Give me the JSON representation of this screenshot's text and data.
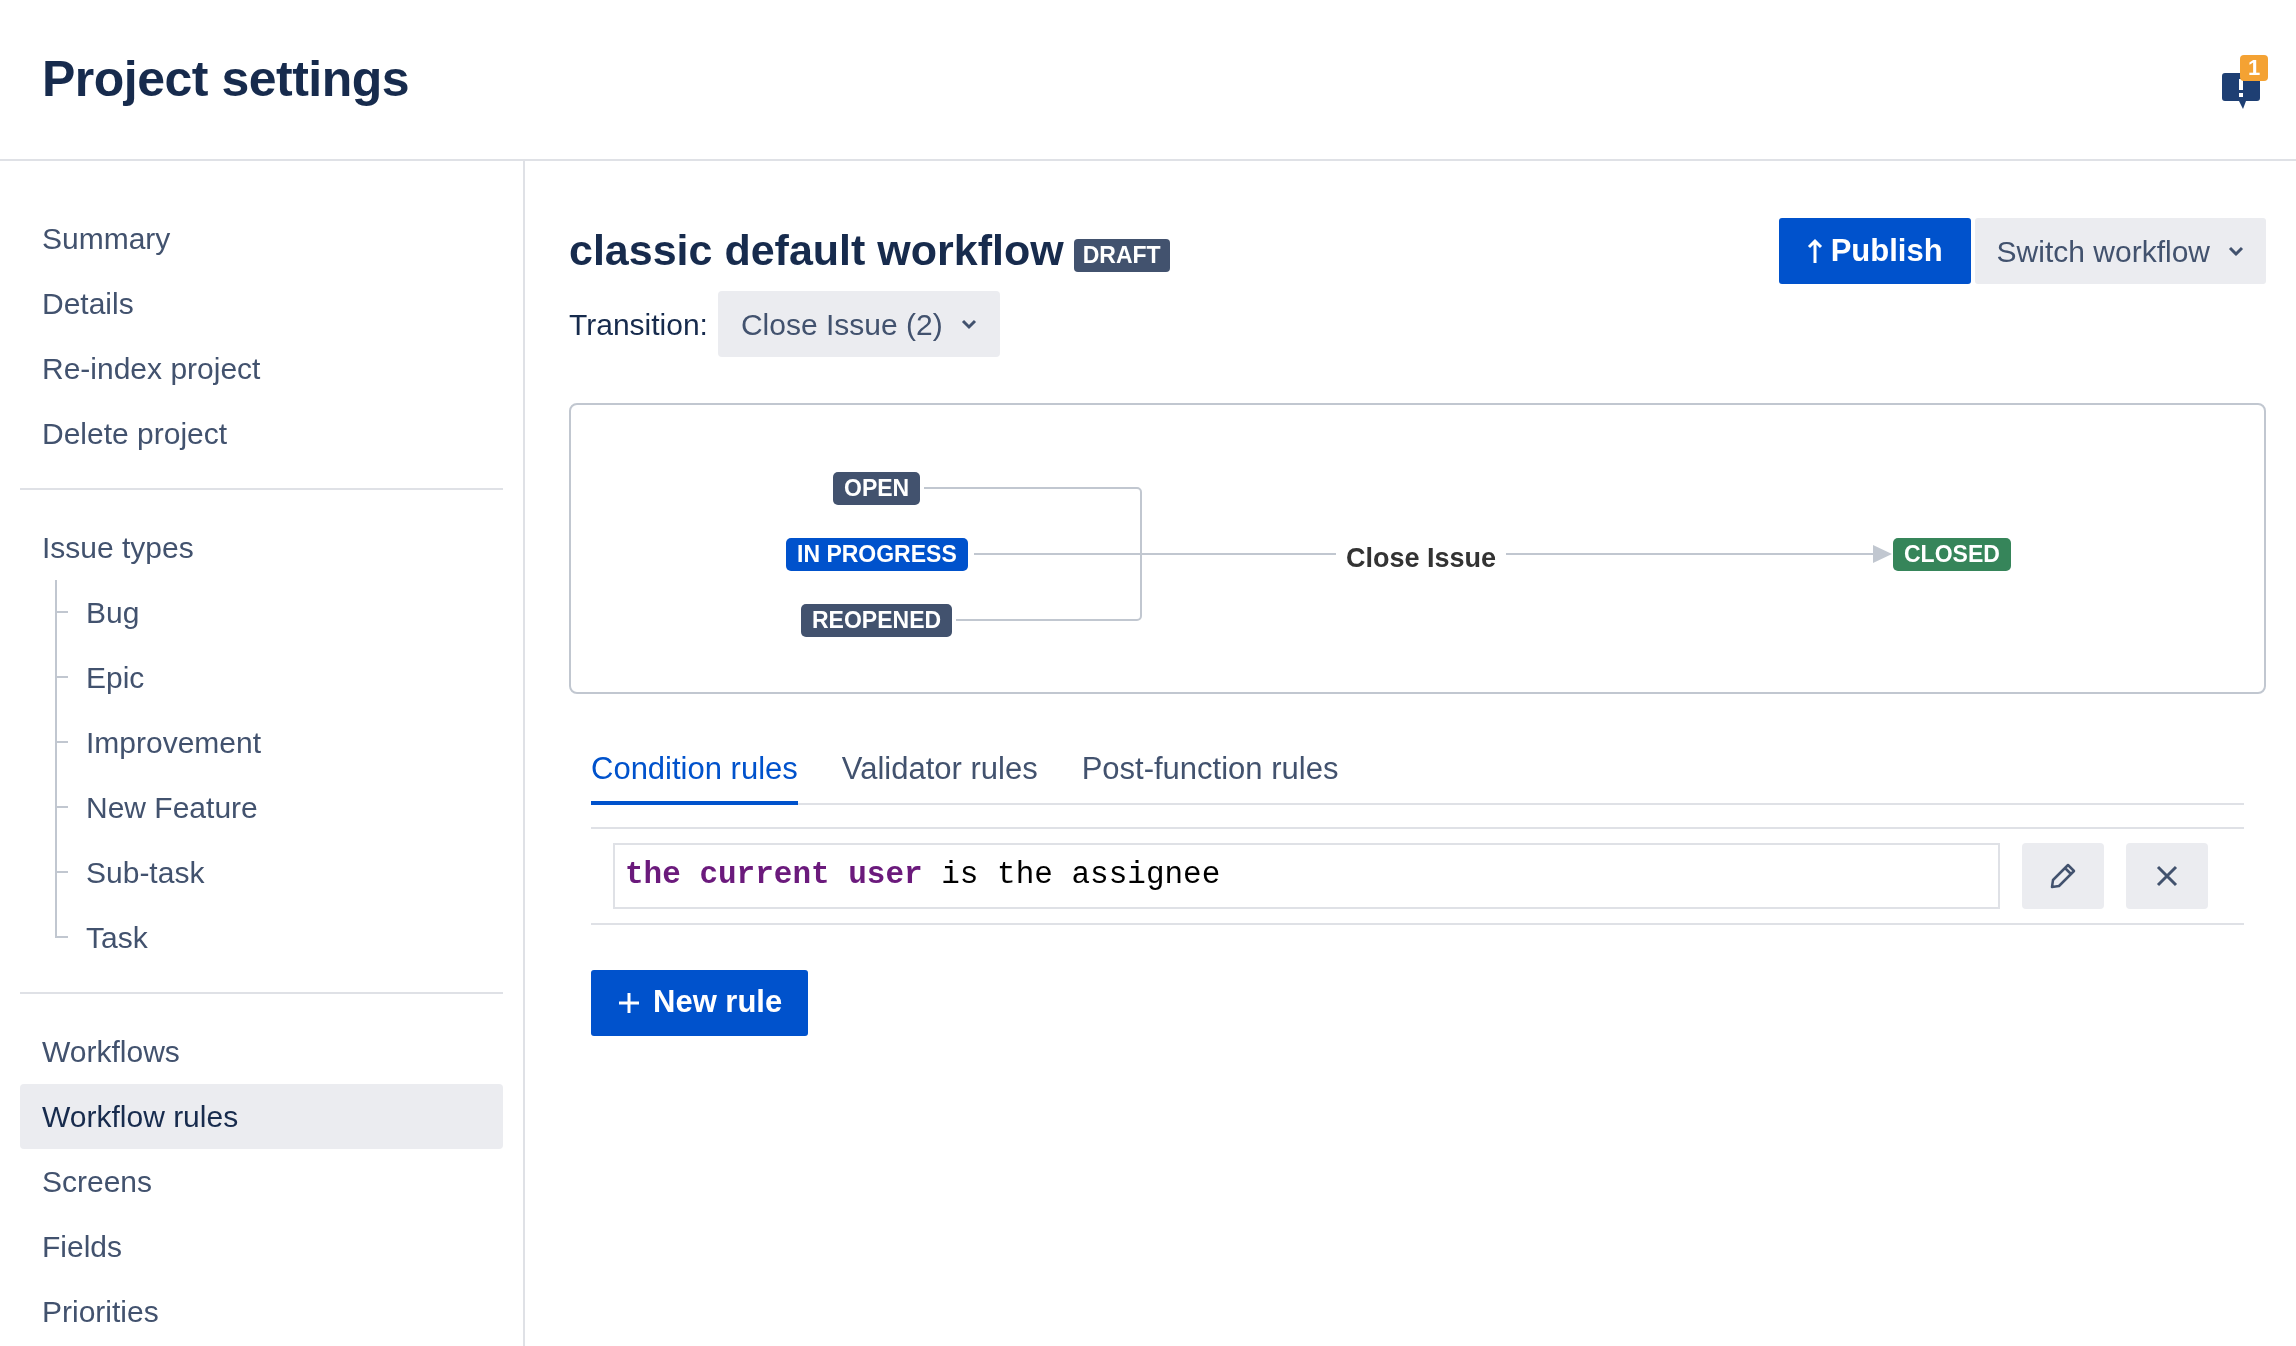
{
  "header": {
    "title": "Project settings",
    "notification_count": "1"
  },
  "sidebar": {
    "sections": [
      {
        "items": [
          {
            "label": "Summary",
            "selected": false
          },
          {
            "label": "Details",
            "selected": false
          },
          {
            "label": "Re-index project",
            "selected": false
          },
          {
            "label": "Delete project",
            "selected": false
          }
        ]
      },
      {
        "items": [
          {
            "label": "Issue types",
            "selected": false,
            "children": [
              {
                "label": "Bug",
                "selected": false
              },
              {
                "label": "Epic",
                "selected": false
              },
              {
                "label": "Improvement",
                "selected": false
              },
              {
                "label": "New Feature",
                "selected": false
              },
              {
                "label": "Sub-task",
                "selected": false
              },
              {
                "label": "Task",
                "selected": false
              }
            ]
          }
        ]
      },
      {
        "items": [
          {
            "label": "Workflows",
            "selected": false
          },
          {
            "label": "Workflow rules",
            "selected": true
          },
          {
            "label": "Screens",
            "selected": false
          },
          {
            "label": "Fields",
            "selected": false
          },
          {
            "label": "Priorities",
            "selected": false
          }
        ]
      }
    ]
  },
  "workflow": {
    "title": "classic default workflow",
    "badge": "DRAFT",
    "publish_button": "Publish",
    "switch_button": "Switch workflow",
    "transition_label": "Transition:",
    "transition_value": "Close Issue (2)"
  },
  "diagram": {
    "sources": [
      {
        "name": "OPEN",
        "color": "#42526e"
      },
      {
        "name": "IN PROGRESS",
        "color": "#0052cc"
      },
      {
        "name": "REOPENED",
        "color": "#42526e"
      }
    ],
    "transition": "Close Issue",
    "target": {
      "name": "CLOSED",
      "color": "#36855a"
    }
  },
  "tabs": [
    {
      "label": "Condition rules",
      "selected": true
    },
    {
      "label": "Validator rules",
      "selected": false
    },
    {
      "label": "Post-function rules",
      "selected": false
    }
  ],
  "rules": [
    {
      "text": "**the current user** is the assignee"
    }
  ],
  "new_rule_button": "New rule"
}
